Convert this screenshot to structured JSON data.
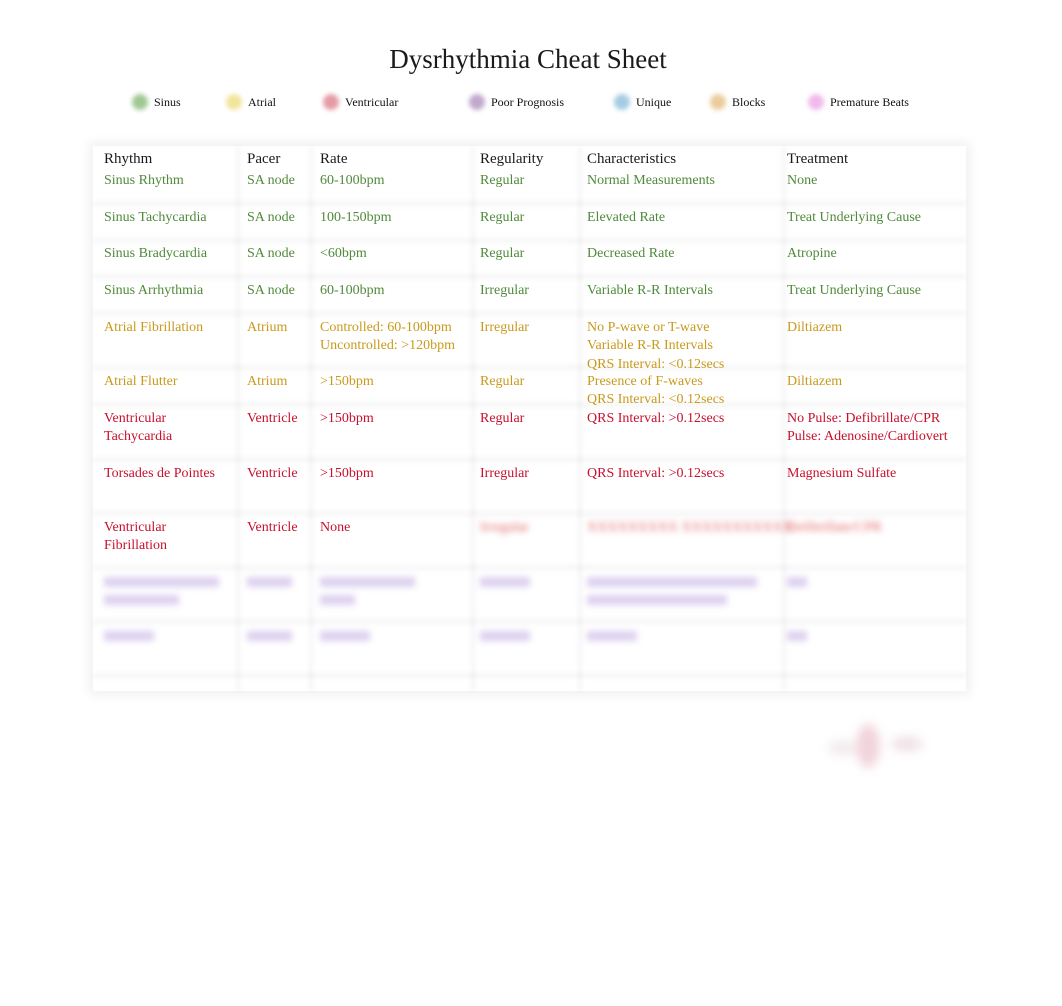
{
  "title": "Dysrhythmia Cheat Sheet",
  "legend": [
    {
      "label": "Sinus",
      "color": "#8fbf80"
    },
    {
      "label": "Atrial",
      "color": "#efe08a"
    },
    {
      "label": "Ventricular",
      "color": "#e08a94"
    },
    {
      "label": "Poor Prognosis",
      "color": "#b79ac4"
    },
    {
      "label": "Unique",
      "color": "#95c3dd"
    },
    {
      "label": "Blocks",
      "color": "#e8c48c"
    },
    {
      "label": "Premature Beats",
      "color": "#efaee6"
    }
  ],
  "colors": {
    "sinus": "#4f8a3a",
    "atrial": "#c89a1c",
    "ventricular": "#c8102e",
    "poor_prognosis": "#a07ad0",
    "blurred_red": "#e06060"
  },
  "table": {
    "headers": [
      "Rhythm",
      "Pacer",
      "Rate",
      "Regularity",
      "Characteristics",
      "Treatment"
    ],
    "rows": [
      {
        "category": "sinus",
        "rhythm": "Sinus Rhythm",
        "pacer": "SA node",
        "rate": "60-100bpm",
        "regularity": "Regular",
        "characteristics": "Normal Measurements",
        "treatment": "None"
      },
      {
        "category": "sinus",
        "rhythm": "Sinus Tachycardia",
        "pacer": "SA node",
        "rate": "100-150bpm",
        "regularity": "Regular",
        "characteristics": "Elevated Rate",
        "treatment": "Treat Underlying Cause"
      },
      {
        "category": "sinus",
        "rhythm": "Sinus Bradycardia",
        "pacer": "SA node",
        "rate": "<60bpm",
        "regularity": "Regular",
        "characteristics": "Decreased Rate",
        "treatment": "Atropine"
      },
      {
        "category": "sinus",
        "rhythm": "Sinus Arrhythmia",
        "pacer": "SA node",
        "rate": "60-100bpm",
        "regularity": "Irregular",
        "characteristics": "Variable R-R Intervals",
        "treatment": "Treat Underlying Cause"
      },
      {
        "category": "atrial",
        "rhythm": "Atrial Fibrillation",
        "pacer": "Atrium",
        "rate": "Controlled: 60-100bpm\nUncontrolled: >120bpm",
        "regularity": "Irregular",
        "characteristics": "No P-wave or T-wave\nVariable R-R Intervals\nQRS Interval: <0.12secs",
        "treatment": "Diltiazem"
      },
      {
        "category": "atrial",
        "rhythm": "Atrial Flutter",
        "pacer": "Atrium",
        "rate": ">150bpm",
        "regularity": "Regular",
        "characteristics": "Presence of F-waves\nQRS Interval: <0.12secs",
        "treatment": "Diltiazem"
      },
      {
        "category": "ventricular",
        "rhythm": "Ventricular\nTachycardia",
        "pacer": "Ventricle",
        "rate": ">150bpm",
        "regularity": "Regular",
        "characteristics": "QRS Interval: >0.12secs",
        "treatment": "No Pulse: Defibrillate/CPR\nPulse: Adenosine/Cardiovert"
      },
      {
        "category": "ventricular",
        "rhythm": "Torsades de Pointes",
        "pacer": "Ventricle",
        "rate": ">150bpm",
        "regularity": "Irregular",
        "characteristics": "QRS Interval: >0.12secs",
        "treatment": "Magnesium Sulfate"
      },
      {
        "category": "ventricular",
        "rhythm": "Ventricular\nFibrillation",
        "pacer": "Ventricle",
        "rate": "None",
        "regularity": "",
        "characteristics": "",
        "treatment": "",
        "blurred": {
          "regularity": true,
          "characteristics": true,
          "treatment": true
        }
      }
    ],
    "blurred_rows": [
      {
        "category": "poor_prognosis"
      },
      {
        "category": "poor_prognosis"
      }
    ]
  }
}
